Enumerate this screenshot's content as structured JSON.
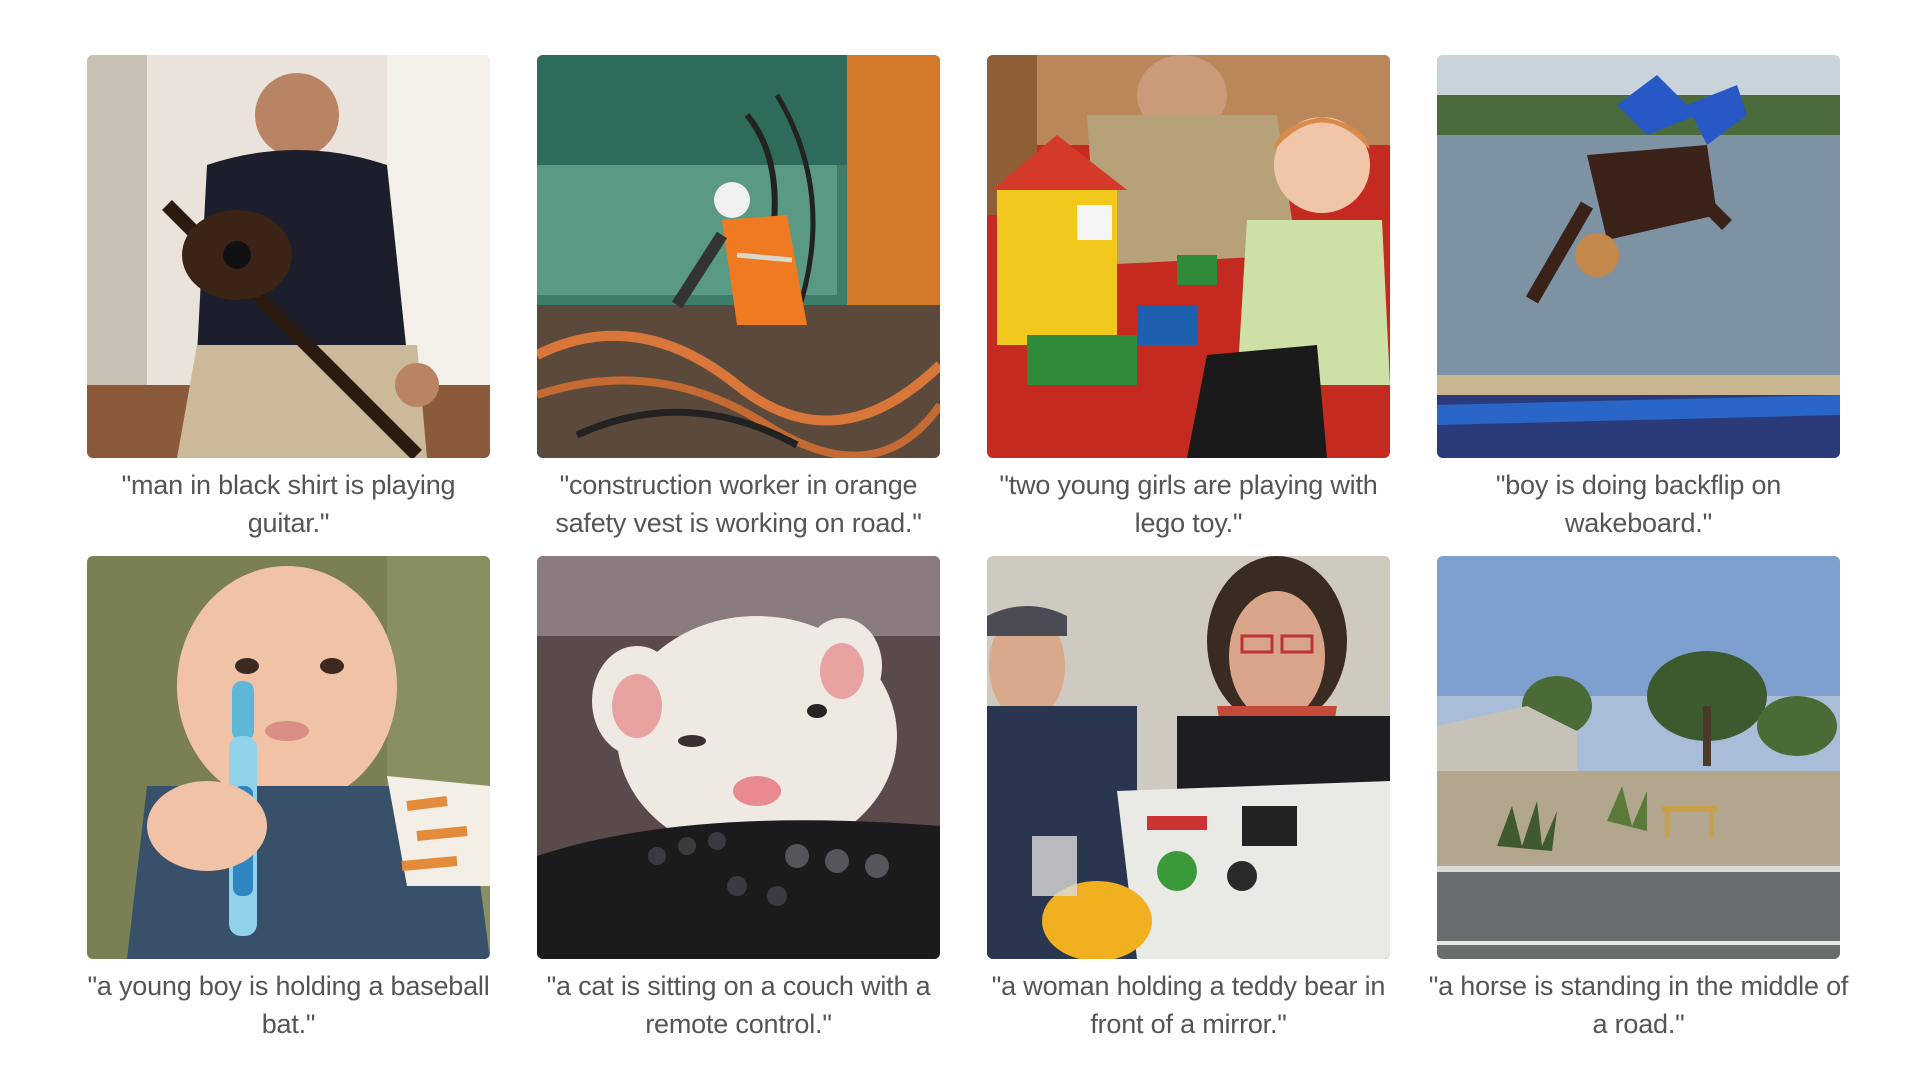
{
  "gallery": {
    "items": [
      {
        "caption": "\"man in black shirt is playing guitar.\"",
        "subject": "man-playing-guitar"
      },
      {
        "caption": "\"construction worker in orange safety vest is working on road.\"",
        "subject": "construction-worker"
      },
      {
        "caption": "\"two young girls are playing with lego toy.\"",
        "subject": "child-with-lego"
      },
      {
        "caption": "\"boy is doing backflip on wakeboard.\"",
        "subject": "boy-backflip"
      },
      {
        "caption": "\"a young boy is holding a baseball bat.\"",
        "subject": "baby-with-toothbrush"
      },
      {
        "caption": "\"a cat is sitting on a couch with a remote control.\"",
        "subject": "ferret-on-remote"
      },
      {
        "caption": "\"a woman holding a teddy bear in front of a mirror.\"",
        "subject": "people-with-laptop"
      },
      {
        "caption": "\"a horse is standing in the middle of a road.\"",
        "subject": "roadside-landscape"
      }
    ]
  }
}
